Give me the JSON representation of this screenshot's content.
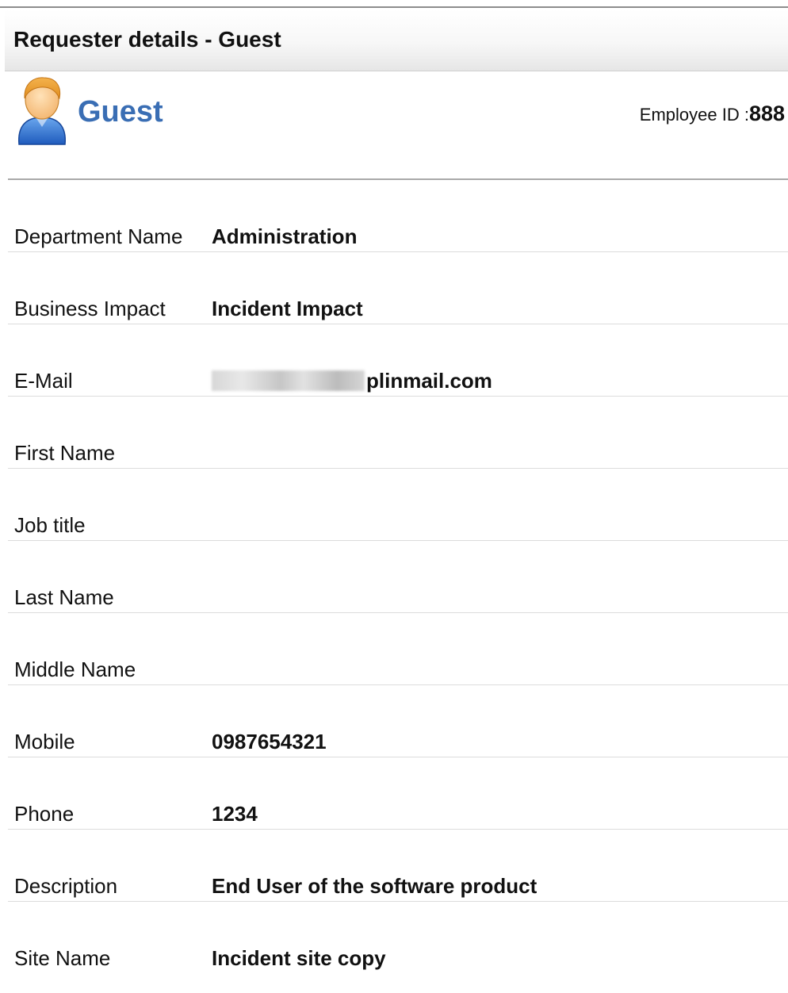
{
  "header": {
    "title": "Requester details - Guest"
  },
  "profile": {
    "name": "Guest",
    "avatar_icon": "user-avatar-icon",
    "employee_id_label": "Employee ID :",
    "employee_id": "888",
    "name_color": "#3a6eb4"
  },
  "fields": [
    {
      "label": "Department Name",
      "value": "Administration"
    },
    {
      "label": "Business Impact",
      "value": "Incident Impact"
    },
    {
      "label": "E-Mail",
      "value": "plinmail.com",
      "redacted_prefix": true
    },
    {
      "label": "First Name",
      "value": ""
    },
    {
      "label": "Job title",
      "value": ""
    },
    {
      "label": "Last Name",
      "value": ""
    },
    {
      "label": "Middle Name",
      "value": ""
    },
    {
      "label": "Mobile",
      "value": "0987654321"
    },
    {
      "label": "Phone",
      "value": "1234"
    },
    {
      "label": "Description",
      "value": "End User of the software product"
    },
    {
      "label": "Site Name",
      "value": "Incident site copy"
    }
  ]
}
